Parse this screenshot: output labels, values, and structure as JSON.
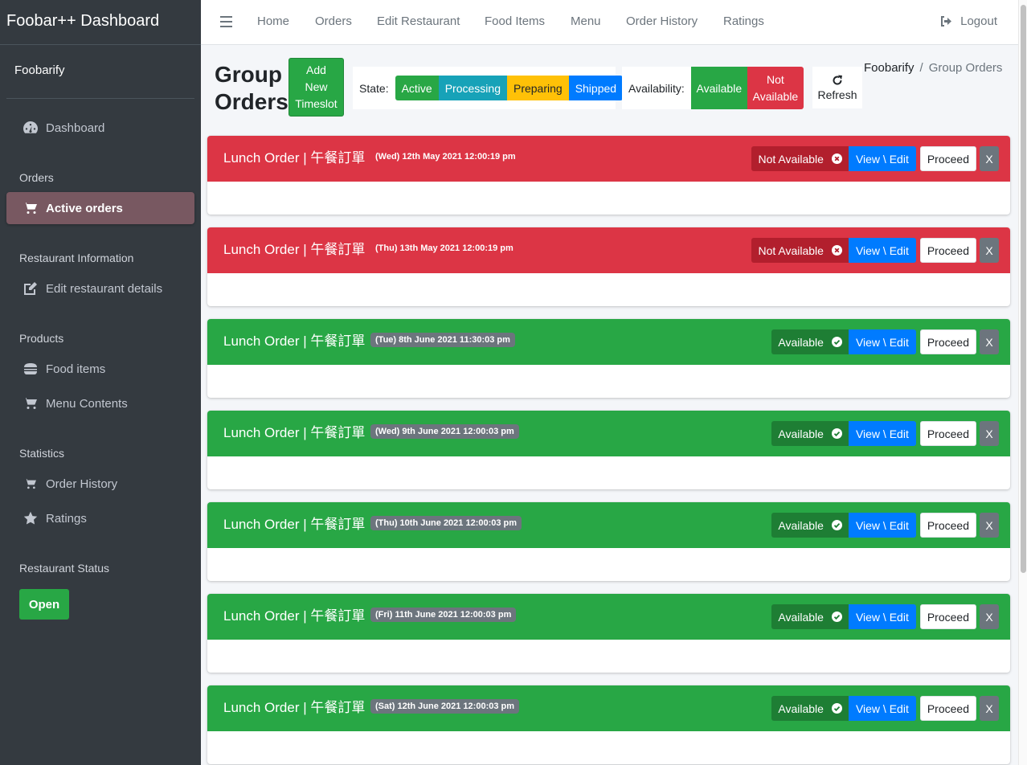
{
  "brand": "Foobar++ Dashboard",
  "sidebar": {
    "user": "Foobarify",
    "sections": [
      {
        "header": "Orders"
      },
      {
        "header": "Restaurant Information"
      },
      {
        "header": "Products"
      },
      {
        "header": "Statistics"
      },
      {
        "header": "Restaurant Status"
      }
    ],
    "items": [
      {
        "label": "Dashboard",
        "icon": "tachometer-icon"
      },
      {
        "label": "Active orders",
        "icon": "cart-icon"
      },
      {
        "label": "Edit restaurant details",
        "icon": "edit-icon"
      },
      {
        "label": "Food items",
        "icon": "hamburger-icon"
      },
      {
        "label": "Menu Contents",
        "icon": "cart-icon"
      },
      {
        "label": "Order History",
        "icon": "cart-icon"
      },
      {
        "label": "Ratings",
        "icon": "star-icon"
      }
    ],
    "status_button": "Open"
  },
  "topnav": {
    "links": [
      "Home",
      "Orders",
      "Edit Restaurant",
      "Food Items",
      "Menu",
      "Order History",
      "Ratings"
    ],
    "logout": "Logout"
  },
  "page": {
    "title_line1": "Group",
    "title_line2": "Orders",
    "add_button": [
      "Add",
      "New",
      "Timeslot"
    ],
    "state_label": "State:",
    "states": [
      "Active",
      "Processing",
      "Preparing",
      "Shipped"
    ],
    "availability_label": "Availability:",
    "available": "Available",
    "not_available": [
      "Not",
      "Available"
    ],
    "refresh": "Refresh",
    "breadcrumb": {
      "root": "Foobarify",
      "sep": "/",
      "current": "Group Orders"
    }
  },
  "orders": [
    {
      "title": "Lunch Order | 午餐訂單",
      "date": "(Wed) 12th May 2021 12:00:19 pm",
      "status": "Not Available",
      "color": "#dc3545"
    },
    {
      "title": "Lunch Order | 午餐訂單",
      "date": "(Thu) 13th May 2021 12:00:19 pm",
      "status": "Not Available",
      "color": "#dc3545"
    },
    {
      "title": "Lunch Order | 午餐訂單",
      "date": "(Tue) 8th June 2021 11:30:03 pm",
      "status": "Available",
      "color": "#28a745"
    },
    {
      "title": "Lunch Order | 午餐訂單",
      "date": "(Wed) 9th June 2021 12:00:03 pm",
      "status": "Available",
      "color": "#28a745"
    },
    {
      "title": "Lunch Order | 午餐訂單",
      "date": "(Thu) 10th June 2021 12:00:03 pm",
      "status": "Available",
      "color": "#28a745"
    },
    {
      "title": "Lunch Order | 午餐訂單",
      "date": "(Fri) 11th June 2021 12:00:03 pm",
      "status": "Available",
      "color": "#28a745"
    },
    {
      "title": "Lunch Order | 午餐訂單",
      "date": "(Sat) 12th June 2021 12:00:03 pm",
      "status": "Available",
      "color": "#28a745"
    }
  ],
  "order_actions": {
    "edit": "View \\ Edit",
    "proceed": "Proceed",
    "delete": "X"
  }
}
